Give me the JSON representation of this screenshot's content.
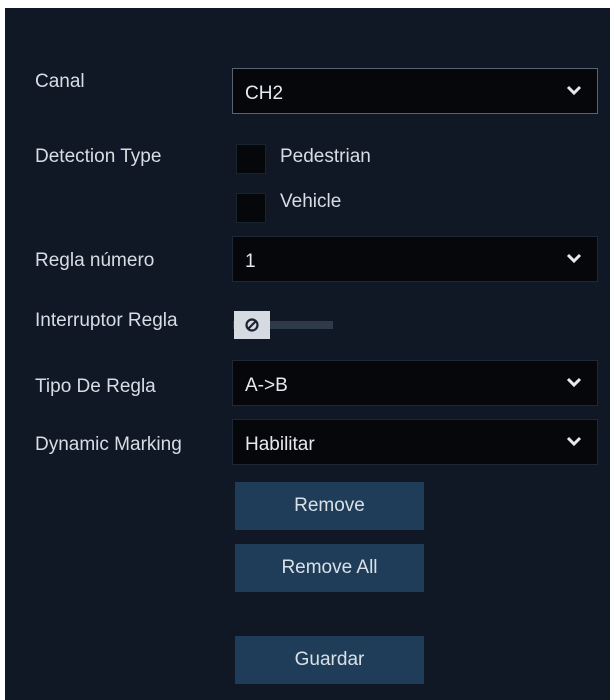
{
  "form": {
    "canal": {
      "label": "Canal",
      "value": "CH2"
    },
    "detection_type": {
      "label": "Detection Type",
      "options": [
        {
          "label": "Pedestrian",
          "checked": false
        },
        {
          "label": "Vehicle",
          "checked": false
        }
      ]
    },
    "regla_numero": {
      "label": "Regla número",
      "value": "1"
    },
    "interruptor_regla": {
      "label": "Interruptor Regla",
      "enabled": false
    },
    "tipo_de_regla": {
      "label": "Tipo De Regla",
      "value": "A->B"
    },
    "dynamic_marking": {
      "label": "Dynamic Marking",
      "value": "Habilitar"
    }
  },
  "buttons": {
    "remove": "Remove",
    "remove_all": "Remove All",
    "guardar": "Guardar"
  },
  "colors": {
    "panel_bg": "#101826",
    "field_bg": "#05070b",
    "button_bg": "#1f3d58",
    "text": "#d8dde4"
  }
}
